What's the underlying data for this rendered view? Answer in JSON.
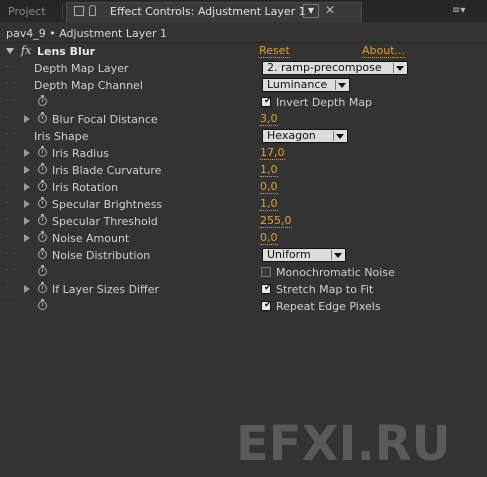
{
  "tabs": {
    "project": "Project",
    "effect_controls": "Effect Controls: Adjustment Layer 1"
  },
  "breadcrumb": "pav4_9 • Adjustment Layer 1",
  "effect": {
    "fx": "fx",
    "name": "Lens Blur",
    "reset": "Reset",
    "about": "About..."
  },
  "rows": {
    "depth_map_layer": {
      "label": "Depth Map Layer",
      "value": "2. ramp-precompose"
    },
    "depth_map_channel": {
      "label": "Depth Map Channel",
      "value": "Luminance"
    },
    "invert_depth_map": {
      "label": "Invert Depth Map",
      "checked": true
    },
    "blur_focal_distance": {
      "label": "Blur Focal Distance",
      "value": "3,0"
    },
    "iris_shape": {
      "label": "Iris Shape",
      "value": "Hexagon"
    },
    "iris_radius": {
      "label": "Iris Radius",
      "value": "17,0"
    },
    "iris_blade_curvature": {
      "label": "Iris Blade Curvature",
      "value": "1,0"
    },
    "iris_rotation": {
      "label": "Iris Rotation",
      "value": "0,0"
    },
    "specular_brightness": {
      "label": "Specular Brightness",
      "value": "1,0"
    },
    "specular_threshold": {
      "label": "Specular Threshold",
      "value": "255,0"
    },
    "noise_amount": {
      "label": "Noise Amount",
      "value": "0,0"
    },
    "noise_distribution": {
      "label": "Noise Distribution",
      "value": "Uniform"
    },
    "monochromatic_noise": {
      "label": "Monochromatic Noise",
      "checked": false
    },
    "if_layer_sizes_differ": {
      "label": "If Layer Sizes Differ"
    },
    "stretch_map_to_fit": {
      "label": "Stretch Map to Fit",
      "checked": true
    },
    "repeat_edge_pixels": {
      "label": "Repeat Edge Pixels",
      "checked": true
    }
  },
  "watermark": "EFXI.RU",
  "colors": {
    "value_accent": "#e0a02f",
    "panel_bg": "#333333"
  }
}
